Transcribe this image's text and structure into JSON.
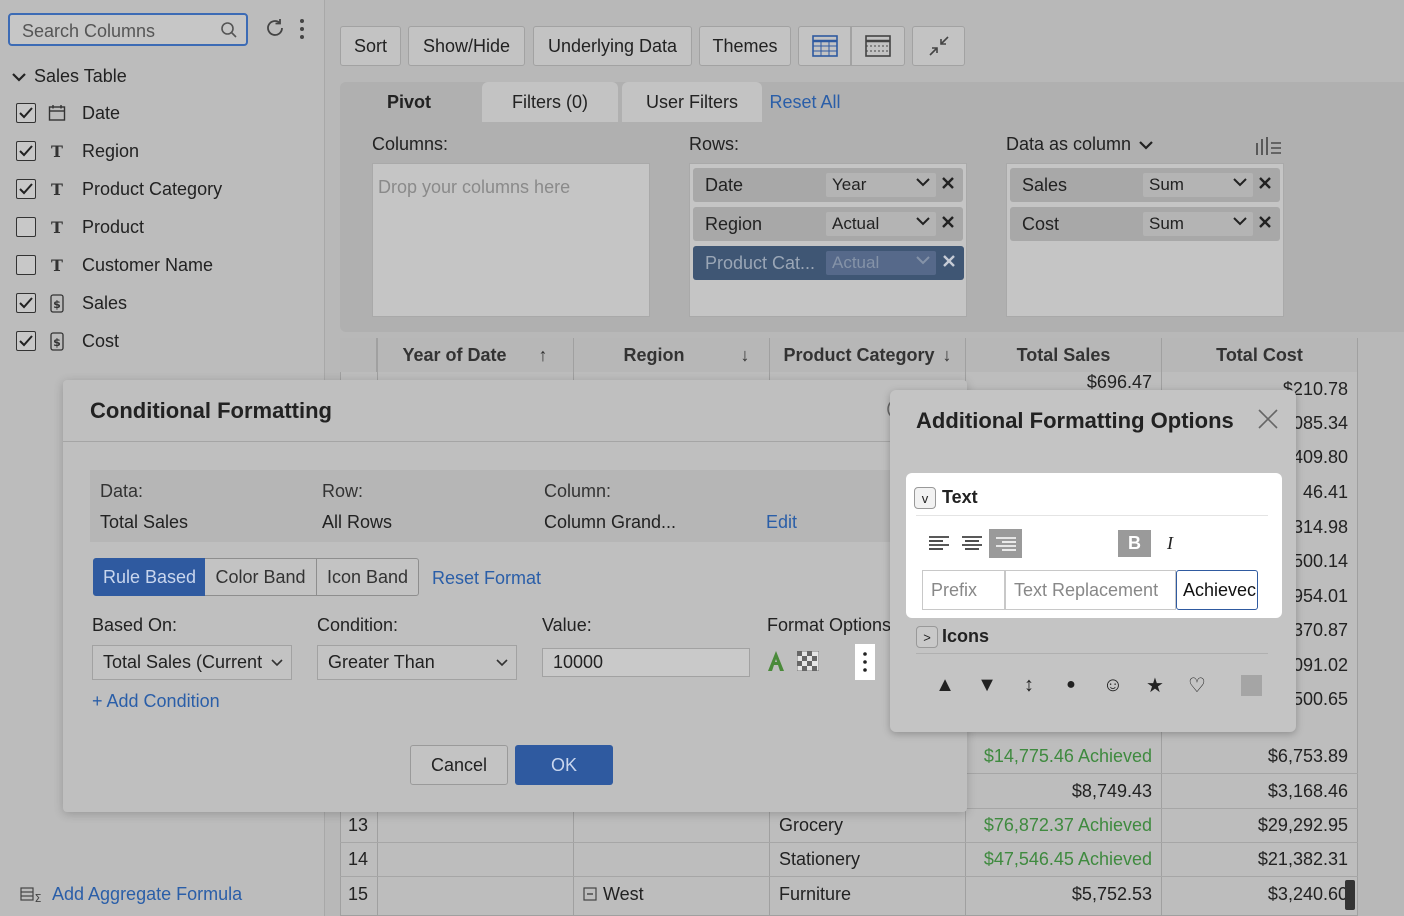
{
  "sidebar": {
    "search_placeholder": "Search Columns",
    "table_name": "Sales Table",
    "fields": [
      {
        "label": "Date",
        "checked": true,
        "type": "date"
      },
      {
        "label": "Region",
        "checked": true,
        "type": "text"
      },
      {
        "label": "Product Category",
        "checked": true,
        "type": "text"
      },
      {
        "label": "Product",
        "checked": false,
        "type": "text"
      },
      {
        "label": "Customer Name",
        "checked": false,
        "type": "text"
      },
      {
        "label": "Sales",
        "checked": true,
        "type": "currency"
      },
      {
        "label": "Cost",
        "checked": true,
        "type": "currency"
      }
    ],
    "add_aggregate": "Add Aggregate Formula"
  },
  "toolbar": {
    "sort": "Sort",
    "show_hide": "Show/Hide",
    "underlying_data": "Underlying Data",
    "themes": "Themes"
  },
  "pivot": {
    "tabs": {
      "pivot": "Pivot",
      "filters": "Filters  (0)",
      "user_filters": "User Filters"
    },
    "reset_all": "Reset All",
    "columns_label": "Columns:",
    "columns_placeholder": "Drop your columns here",
    "rows_label": "Rows:",
    "rows": [
      {
        "name": "Date",
        "option": "Year"
      },
      {
        "name": "Region",
        "option": "Actual"
      },
      {
        "name": "Product Cat...",
        "option": "Actual"
      }
    ],
    "data_label": "Data as column",
    "data": [
      {
        "name": "Sales",
        "option": "Sum"
      },
      {
        "name": "Cost",
        "option": "Sum"
      }
    ]
  },
  "table": {
    "headers": [
      "Year of Date",
      "Region",
      "Product Category",
      "Total Sales",
      "Total Cost"
    ],
    "partial_top_sales": "$696.47",
    "right_cost_fragments": [
      "$210.78",
      "085.34",
      "409.80",
      "46.41",
      "314.98",
      "500.14",
      "954.01",
      "370.87",
      "091.02",
      "500.65"
    ],
    "rows": [
      {
        "num": "",
        "region": "",
        "category": "",
        "sales": "$14,775.46 Achieved",
        "achieved": true,
        "cost": "$6,753.89"
      },
      {
        "num": "",
        "region": "",
        "category": "",
        "sales": "$8,749.43",
        "achieved": false,
        "cost": "$3,168.46"
      },
      {
        "num": "13",
        "region": "",
        "category": "Grocery",
        "sales": "$76,872.37 Achieved",
        "achieved": true,
        "cost": "$29,292.95"
      },
      {
        "num": "14",
        "region": "",
        "category": "Stationery",
        "sales": "$47,546.45 Achieved",
        "achieved": true,
        "cost": "$21,382.31"
      },
      {
        "num": "15",
        "region": "West",
        "category": "Furniture",
        "sales": "$5,752.53",
        "achieved": false,
        "cost": "$3,240.60"
      }
    ]
  },
  "cf_dialog": {
    "title": "Conditional Formatting",
    "data_label": "Data:",
    "data_value": "Total Sales",
    "row_label": "Row:",
    "row_value": "All Rows",
    "column_label": "Column:",
    "column_value": "Column Grand...",
    "edit": "Edit",
    "modes": [
      "Rule Based",
      "Color Band",
      "Icon Band"
    ],
    "reset_format": "Reset Format",
    "based_on_label": "Based On:",
    "based_on_value": "Total Sales (Current",
    "condition_label": "Condition:",
    "condition_value": "Greater Than",
    "value_label": "Value:",
    "value": "10000",
    "format_options_label": "Format Options",
    "add_condition": "+ Add Condition",
    "cancel": "Cancel",
    "ok": "OK"
  },
  "af_popup": {
    "title": "Additional Formatting Options",
    "text_section": "Text",
    "text_toggle": "v",
    "bold": "B",
    "italic": "I",
    "prefix_placeholder": "Prefix",
    "replacement_placeholder": "Text Replacement",
    "suffix_value": "Achievec",
    "icons_section": "Icons",
    "icons_toggle": ">",
    "icons": [
      "▲",
      "▼",
      "↕",
      "●",
      "☺",
      "★",
      "♡"
    ]
  },
  "colors": {
    "accent": "#2f5aa0",
    "link": "#2a5ea8",
    "achieved": "#3f8a3f"
  }
}
